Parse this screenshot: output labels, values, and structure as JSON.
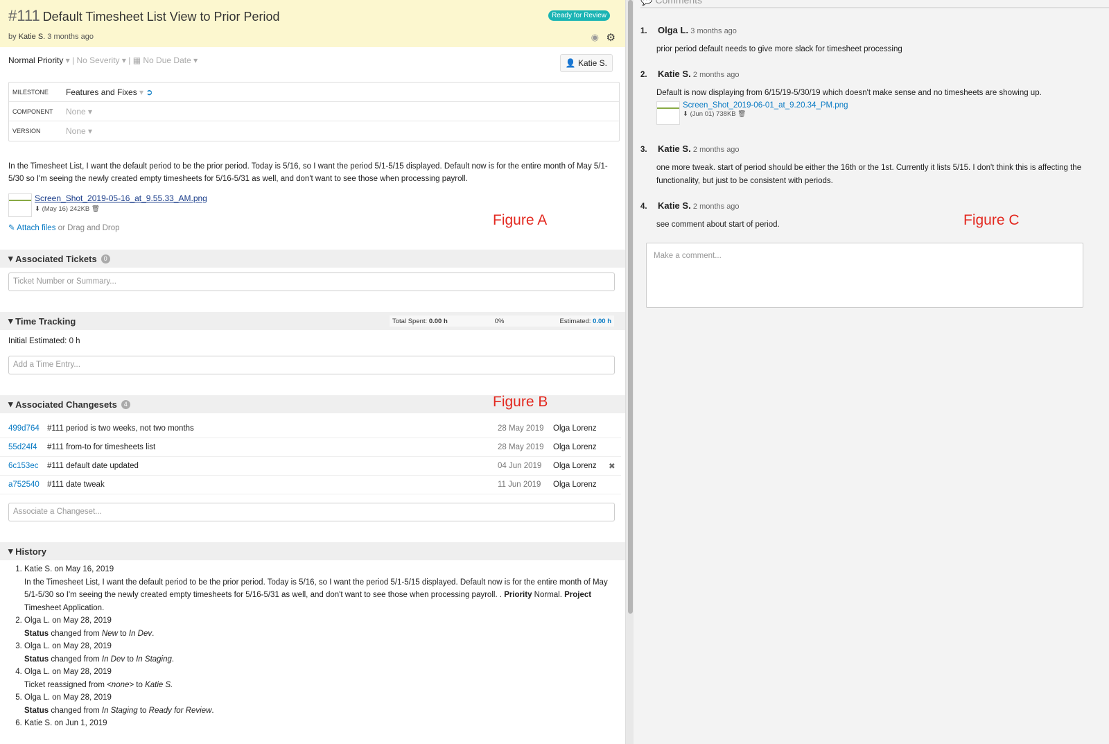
{
  "ticket": {
    "number": "#111",
    "title": "Default Timesheet List View to Prior Period",
    "author_prefix": "by",
    "author": "Katie S.",
    "age": "3 months ago",
    "status": "Ready for Review",
    "status_color": "#1ab4b4",
    "priority": "Normal Priority",
    "severity": "No Severity",
    "due_date": "No Due Date",
    "assignee": "Katie S."
  },
  "fields": [
    {
      "label": "MILESTONE",
      "value": "Features and Fixes"
    },
    {
      "label": "COMPONENT",
      "value": "None"
    },
    {
      "label": "VERSION",
      "value": "None"
    }
  ],
  "description": "In the Timesheet List, I want the default period to be the prior period. Today is 5/16, so I want the period 5/1-5/15 displayed. Default now is for the entire month of May 5/1-5/30 so I'm seeing the newly created empty timesheets for 5/16-5/31 as well, and don't want to see those when processing payroll.",
  "attachment": {
    "name": "Screen_Shot_2019-05-16_at_9.55.33_AM.png",
    "meta": "(May 16) 242KB"
  },
  "attach_files": "Attach files",
  "drag_drop": "or Drag and Drop",
  "figures": {
    "a": "Figure A",
    "b": "Figure B",
    "c": "Figure C"
  },
  "associated_tickets": {
    "title": "Associated Tickets",
    "count": "0",
    "placeholder": "Ticket Number or Summary..."
  },
  "time_tracking": {
    "title": "Time Tracking",
    "total_label": "Total Spent:",
    "total": "0.00 h",
    "percent": "0%",
    "est_label": "Estimated:",
    "est": "0.00 h",
    "initial": "Initial Estimated: 0 h",
    "placeholder": "Add a Time Entry..."
  },
  "changesets": {
    "title": "Associated Changesets",
    "count": "4",
    "placeholder": "Associate a Changeset...",
    "rows": [
      {
        "hash": "499d764",
        "msg": "#111 period is two weeks, not two months",
        "date": "28 May 2019",
        "user": "Olga Lorenz"
      },
      {
        "hash": "55d24f4",
        "msg": "#111 from-to for timesheets list",
        "date": "28 May 2019",
        "user": "Olga Lorenz"
      },
      {
        "hash": "6c153ec",
        "msg": "#111 default date updated",
        "date": "04 Jun 2019",
        "user": "Olga Lorenz"
      },
      {
        "hash": "a752540",
        "msg": "#111 date tweak",
        "date": "11 Jun 2019",
        "user": "Olga Lorenz"
      }
    ]
  },
  "history": {
    "title": "History"
  },
  "comments": {
    "title": "Comments",
    "placeholder": "Make a comment...",
    "items": [
      {
        "n": "1.",
        "author": "Olga L.",
        "time": "3 months ago",
        "body": "prior period default needs to give more slack for timesheet processing"
      },
      {
        "n": "2.",
        "author": "Katie S.",
        "time": "2 months ago",
        "body": "Default is now displaying from 6/15/19-5/30/19 which doesn't make sense and no timesheets are showing up.",
        "att_name": "Screen_Shot_2019-06-01_at_9.20.34_PM.png",
        "att_meta": "(Jun 01) 738KB"
      },
      {
        "n": "3.",
        "author": "Katie S.",
        "time": "2 months ago",
        "body": "one more tweak. start of period should be either the 16th or the 1st. Currently it lists 5/15. I don't think this is affecting the functionality, but just to be consistent with periods."
      },
      {
        "n": "4.",
        "author": "Katie S.",
        "time": "2 months ago",
        "body": "see comment about start of period."
      }
    ]
  }
}
